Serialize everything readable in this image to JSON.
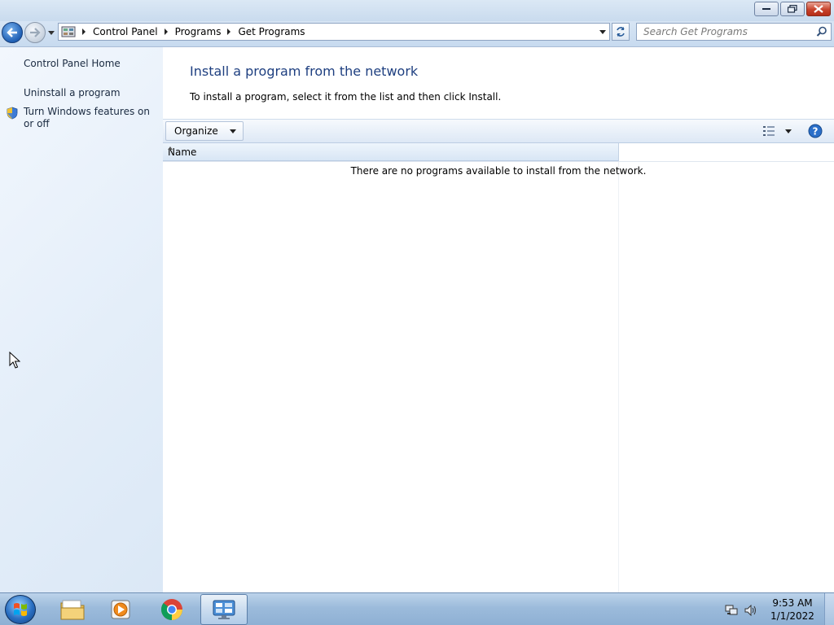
{
  "window": {
    "minimize_label": "Minimize",
    "maximize_label": "Restore",
    "close_label": "Close"
  },
  "navigation": {
    "back_icon": "back-arrow-icon",
    "forward_icon": "forward-arrow-icon",
    "breadcrumbs": [
      "Control Panel",
      "Programs",
      "Get Programs"
    ],
    "search_placeholder": "Search Get Programs"
  },
  "sidebar": {
    "items": [
      {
        "label": "Control Panel Home"
      },
      {
        "label": "Uninstall a program"
      },
      {
        "label": "Turn Windows features on or off",
        "icon": "shield-icon"
      }
    ]
  },
  "main": {
    "title": "Install a program from the network",
    "instructions": "To install a program, select it from the list and then click Install.",
    "toolbar": {
      "organize_label": "Organize"
    },
    "columns": [
      "Name"
    ],
    "empty_message": "There are no programs available to install from the network."
  },
  "taskbar": {
    "pinned": [
      "windows-explorer-icon",
      "media-player-icon",
      "chrome-icon",
      "control-panel-icon"
    ],
    "active": "control-panel-icon",
    "clock_time": "9:53 AM",
    "clock_date": "1/1/2022"
  },
  "colors": {
    "accent_title": "#1e3f80",
    "sidebar_bg": "#e4eef9",
    "taskbar_bg": "#9cbbdb"
  }
}
